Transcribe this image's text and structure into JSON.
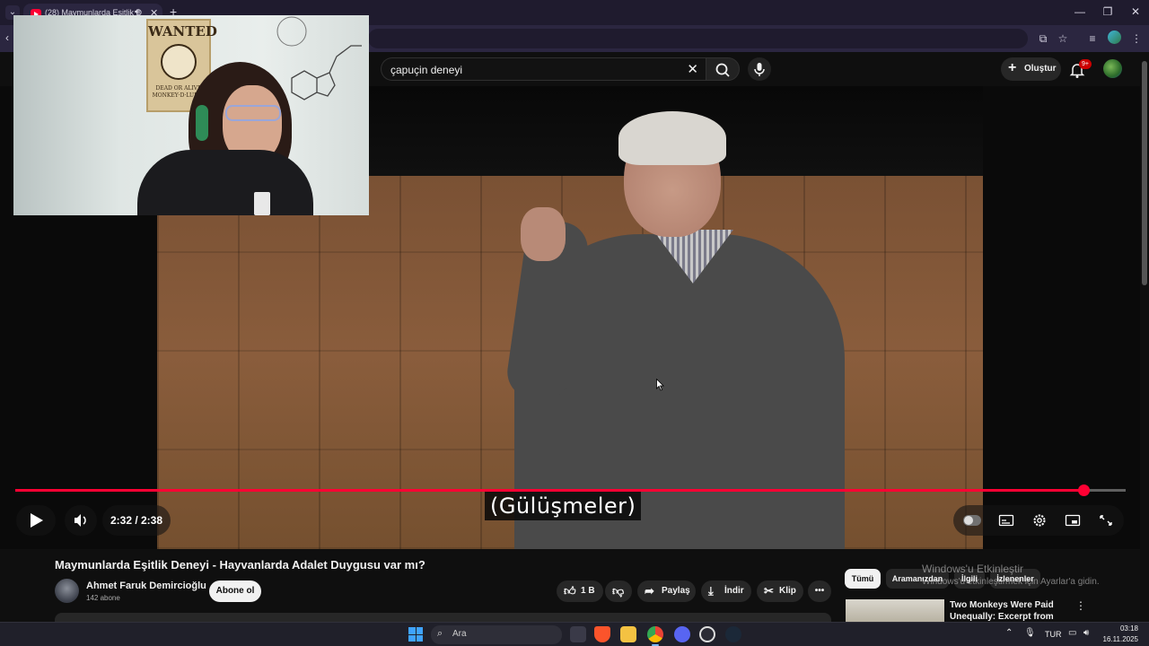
{
  "browser": {
    "tab_title": "(28) Maymunlarda Eşitlik D",
    "tab_favicon": "youtube-icon",
    "new_tab": "+",
    "window_controls": [
      "—",
      "❐",
      "✕"
    ]
  },
  "youtube": {
    "search_query": "çapuçin deneyi",
    "create_label": "Oluştur",
    "notification_count": "9+"
  },
  "player": {
    "subtitle": "(Gülüşmeler)",
    "time": "2:32 / 2:38",
    "progress_fraction": 0.962,
    "accent_color": "#ff0033"
  },
  "webcam": {
    "poster_title": "WANTED",
    "poster_sub": "DEAD OR ALIVE MONKEY·D·LUFFY"
  },
  "video": {
    "title": "Maymunlarda Eşitlik Deneyi - Hayvanlarda Adalet Duygusu var mı?",
    "channel": "Ahmet Faruk Demircioğlu",
    "subscribers": "142 abone",
    "subscribe_label": "Abone ol",
    "likes": "1 B",
    "share_label": "Paylaş",
    "download_label": "İndir",
    "clip_label": "Klip"
  },
  "chips": [
    "Tümü",
    "Aramanızdan",
    "İlgili",
    "İzlenenler"
  ],
  "activation": {
    "title": "Windows'u Etkinleştir",
    "subtitle": "Windows'u etkinleştirmek için Ayarlar'a gidin."
  },
  "recommendation": {
    "title": "Two Monkeys Were Paid Unequally: Excerpt from Frans"
  },
  "taskbar": {
    "search_placeholder": "Ara",
    "language": "TUR",
    "time": "03:18",
    "date": "16.11.2025"
  }
}
